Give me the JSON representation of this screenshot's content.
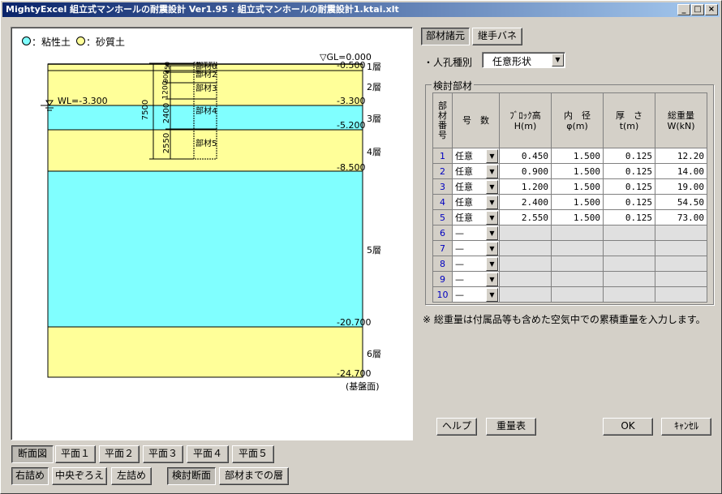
{
  "title": "MightyExcel 組立式マンホールの耐震設計 Ver1.95 : 組立式マンホールの耐震設計1.ktai.xlt",
  "caption_buttons": [
    "_",
    "□",
    "×"
  ],
  "legend": {
    "clay": "：粘性土",
    "sand": "：砂質土"
  },
  "colors": {
    "clay": "#80ffff",
    "sand": "#ffff99",
    "title": "#0a246a"
  },
  "diagram": {
    "gl_label": "▽GL=0.000",
    "wl_label": "WL=-3.300",
    "base_label": "(基盤面)",
    "layers": [
      {
        "name": "1層",
        "bottom": "-0.500",
        "type": "sand"
      },
      {
        "name": "2層",
        "bottom": "-3.300",
        "type": "sand"
      },
      {
        "name": "3層",
        "bottom": "-5.200",
        "type": "clay"
      },
      {
        "name": "4層",
        "bottom": "-8.500",
        "type": "sand"
      },
      {
        "name": "5層",
        "bottom": "-20.700",
        "type": "clay"
      },
      {
        "name": "6層",
        "bottom": "-24.700",
        "type": "sand"
      }
    ],
    "members": [
      "部材0",
      "部材1",
      "部材2",
      "部材3",
      "部材4",
      "部材5"
    ],
    "dims": {
      "total": "7500",
      "d2400": "2400",
      "d2550": "2550",
      "d1200": "1200",
      "d900": "900",
      "d450": "450"
    }
  },
  "tabs_top": [
    "部材諸元",
    "継手バネ"
  ],
  "hole_type": {
    "label": "・人孔種別",
    "value": "任意形状"
  },
  "group_label": "検討部材",
  "grid": {
    "headers": {
      "idx": [
        "部",
        "材",
        "番",
        "号"
      ],
      "type": "号　数",
      "height": [
        "ﾌﾞﾛｯｸ高",
        "H(m)"
      ],
      "diameter": [
        "内　径",
        "φ(m)"
      ],
      "thickness": [
        "厚　さ",
        "t(m)"
      ],
      "weight": [
        "総重量",
        "W(kN)"
      ]
    },
    "rows": [
      {
        "no": "1",
        "type": "任意",
        "h": "0.450",
        "d": "1.500",
        "t": "0.125",
        "w": "12.20"
      },
      {
        "no": "2",
        "type": "任意",
        "h": "0.900",
        "d": "1.500",
        "t": "0.125",
        "w": "14.00"
      },
      {
        "no": "3",
        "type": "任意",
        "h": "1.200",
        "d": "1.500",
        "t": "0.125",
        "w": "19.00"
      },
      {
        "no": "4",
        "type": "任意",
        "h": "2.400",
        "d": "1.500",
        "t": "0.125",
        "w": "54.50"
      },
      {
        "no": "5",
        "type": "任意",
        "h": "2.550",
        "d": "1.500",
        "t": "0.125",
        "w": "73.00"
      },
      {
        "no": "6",
        "type": "—",
        "h": "",
        "d": "",
        "t": "",
        "w": ""
      },
      {
        "no": "7",
        "type": "—",
        "h": "",
        "d": "",
        "t": "",
        "w": ""
      },
      {
        "no": "8",
        "type": "—",
        "h": "",
        "d": "",
        "t": "",
        "w": ""
      },
      {
        "no": "9",
        "type": "—",
        "h": "",
        "d": "",
        "t": "",
        "w": ""
      },
      {
        "no": "10",
        "type": "—",
        "h": "",
        "d": "",
        "t": "",
        "w": ""
      }
    ]
  },
  "note": "※ 総重量は付属品等も含めた空気中での累積重量を入力します。",
  "footer_buttons": {
    "help": "ヘルプ",
    "weight_table": "重量表",
    "ok": "OK",
    "cancel": "ｷｬﾝｾﾙ"
  },
  "view_tabs": [
    "断面図",
    "平面１",
    "平面２",
    "平面３",
    "平面４",
    "平面５"
  ],
  "align_tabs": [
    "右詰め",
    "中央ぞろえ",
    "左詰め"
  ],
  "section_tabs": [
    "検討断面",
    "部材までの層"
  ]
}
